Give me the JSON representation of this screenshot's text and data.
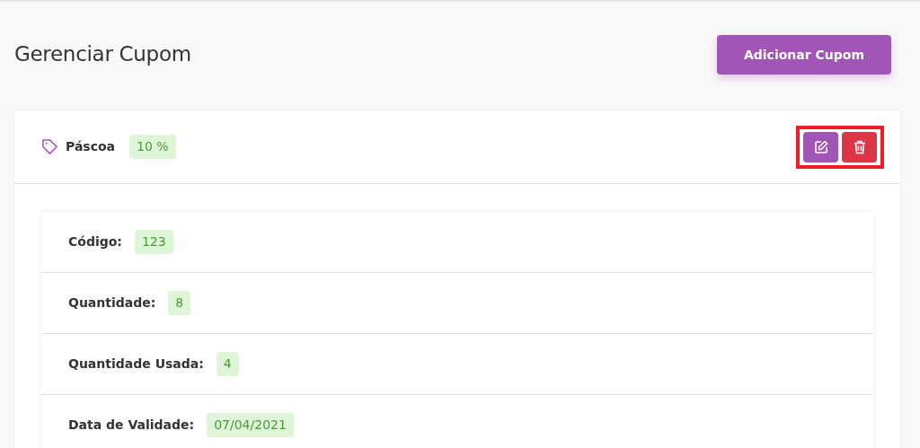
{
  "page": {
    "title": "Gerenciar Cupom",
    "add_button": "Adicionar Cupom"
  },
  "coupon": {
    "name": "Páscoa",
    "discount": "10 %",
    "actions_highlighted": true,
    "details": [
      {
        "label": "Código:",
        "value": "123"
      },
      {
        "label": "Quantidade:",
        "value": "8"
      },
      {
        "label": "Quantidade Usada:",
        "value": "4"
      },
      {
        "label": "Data de Validade:",
        "value": "07/04/2021"
      }
    ]
  }
}
